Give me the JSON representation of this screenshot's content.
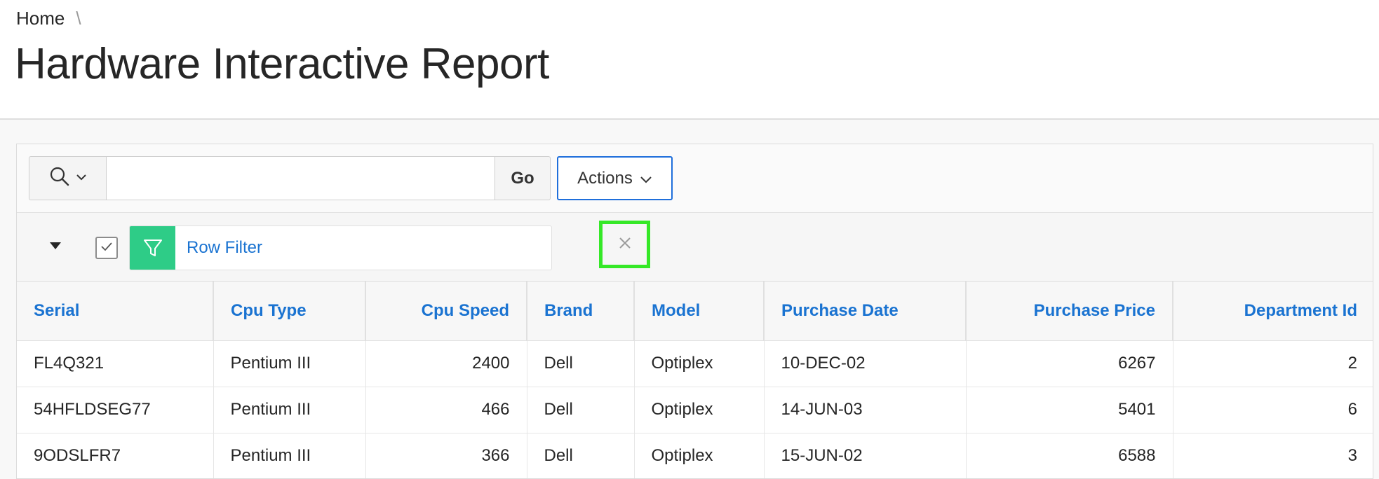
{
  "breadcrumb": {
    "home": "Home",
    "separator": "\\"
  },
  "page": {
    "title": "Hardware Interactive Report"
  },
  "toolbar": {
    "search_value": "",
    "go_label": "Go",
    "actions_label": "Actions"
  },
  "filter": {
    "label": "Row Filter",
    "enabled": true
  },
  "colors": {
    "link": "#1a73d1",
    "filter_icon_bg": "#2ecc87",
    "focus_border": "#1f6fdb",
    "highlight": "#35e827"
  },
  "icons": [
    "search-icon",
    "chevron-down-icon",
    "caret-down-icon",
    "check-icon",
    "filter-icon",
    "close-icon"
  ],
  "report": {
    "columns": [
      "Serial",
      "Cpu Type",
      "Cpu Speed",
      "Brand",
      "Model",
      "Purchase Date",
      "Purchase Price",
      "Department Id"
    ],
    "rows": [
      [
        "FL4Q321",
        "Pentium III",
        "2400",
        "Dell",
        "Optiplex",
        "10-DEC-02",
        "6267",
        "2"
      ],
      [
        "54HFLDSEG77",
        "Pentium III",
        "466",
        "Dell",
        "Optiplex",
        "14-JUN-03",
        "5401",
        "6"
      ],
      [
        "9ODSLFR7",
        "Pentium III",
        "366",
        "Dell",
        "Optiplex",
        "15-JUN-02",
        "6588",
        "3"
      ]
    ]
  }
}
